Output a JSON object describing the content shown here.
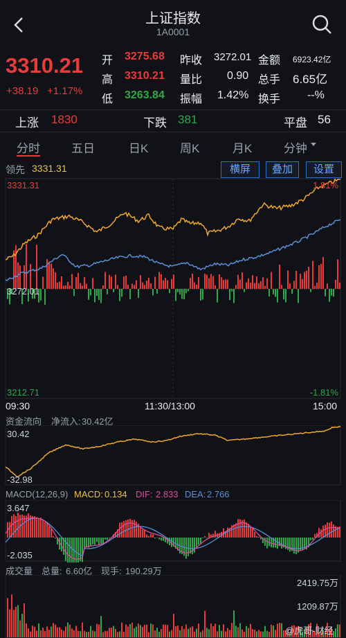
{
  "header": {
    "title": "上证指数",
    "code": "1A0001",
    "back_icon": "chevron-left-icon",
    "search_icon": "search-icon"
  },
  "quote": {
    "price": "3310.21",
    "change": "+38.19",
    "change_pct": "+1.17%",
    "open_label": "开",
    "open": "3275.68",
    "prev_close_label": "昨收",
    "prev_close": "3272.01",
    "amount_label": "金额",
    "amount": "6923.42亿",
    "high_label": "高",
    "high": "3310.21",
    "vol_ratio_label": "量比",
    "vol_ratio": "0.90",
    "total_hands_label": "总手",
    "total_hands": "6.65亿",
    "low_label": "低",
    "low": "3263.84",
    "amplitude_label": "振幅",
    "amplitude": "1.42%",
    "turnover_label": "换手",
    "turnover": "--%"
  },
  "breadth": {
    "up_label": "上涨",
    "up": "1830",
    "down_label": "下跌",
    "down": "381",
    "flat_label": "平盘",
    "flat": "56"
  },
  "tabs": [
    "分时",
    "五日",
    "日K",
    "周K",
    "月K",
    "分钟"
  ],
  "active_tab": "分时",
  "toolbar": {
    "leader_label": "领先",
    "leader_value": "3331.31",
    "landscape": "横屏",
    "overlay": "叠加",
    "settings": "设置"
  },
  "intraday": {
    "y_top": "3331.31",
    "y_mid": "3272.01",
    "y_bottom": "3212.71",
    "pct_top": "1.81%",
    "pct_bottom": "-1.81%",
    "t_start": "09:30",
    "t_mid": "11:30/13:00",
    "t_end": "15:00"
  },
  "fund_flow": {
    "title": "资金流向",
    "net_label": "净流入:",
    "net_value": "30.42亿",
    "y_top": "30.42",
    "y_bottom": "-32.98"
  },
  "macd": {
    "title": "MACD(12,26,9)",
    "macd_label": "MACD:",
    "macd_value": "0.134",
    "dif_label": "DIF:",
    "dif_value": "2.833",
    "dea_label": "DEA:",
    "dea_value": "2.766",
    "y_top": "3.647",
    "y_bottom": "-2.035"
  },
  "volume": {
    "title": "成交量",
    "total_label": "总量:",
    "total_value": "6.60亿",
    "current_label": "现手:",
    "current_value": "190.29万",
    "y_top": "2419.75万",
    "y_mid": "1209.87万"
  },
  "watermark": "@虎哥-财经",
  "colors": {
    "up": "#ea3b3b",
    "down": "#2ea84a",
    "price_line": "#f0a830",
    "avg_line": "#5b8fd6",
    "dea_line": "#e04aa0",
    "accent": "#2b6fd0"
  }
}
